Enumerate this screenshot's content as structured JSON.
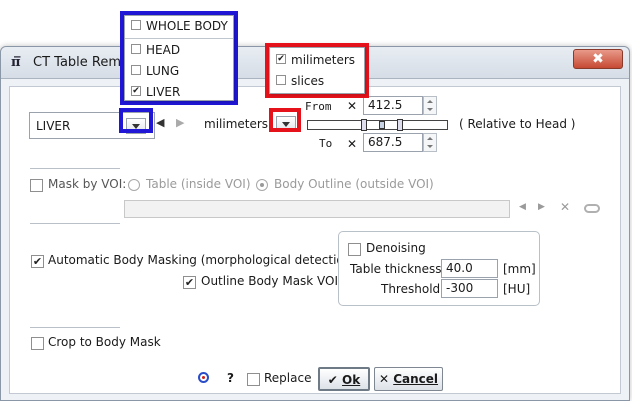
{
  "window": {
    "title": "CT Table Rem",
    "app_icon": "π̅",
    "close_symbol": "✖"
  },
  "region": {
    "selected": "LIVER",
    "options": [
      {
        "label": "WHOLE BODY",
        "checked": false
      },
      {
        "label": "HEAD",
        "checked": false
      },
      {
        "label": "LUNG",
        "checked": false
      },
      {
        "label": "LIVER",
        "checked": true
      }
    ]
  },
  "units": {
    "selected": "milimeters",
    "options": [
      {
        "label": "milimeters",
        "checked": true
      },
      {
        "label": "slices",
        "checked": false
      }
    ]
  },
  "range": {
    "from_label": "From",
    "from_value": "412.5",
    "to_label": "To",
    "to_value": "687.5",
    "clear_symbol": "✕",
    "relative_label": "( Relative to Head )"
  },
  "mask": {
    "mask_by_voi_label": "Mask by VOI:",
    "table_inside_label": "Table (inside VOI)",
    "body_outline_label": "Body Outline (outside VOI)",
    "voi_path": ""
  },
  "body_masking": {
    "auto_label": "Automatic Body Masking (morphological detection)",
    "auto_checked": true,
    "outline_label": "Outline Body Mask VOI",
    "outline_checked": true,
    "denoising_label": "Denoising",
    "table_thickness_label": "Table thickness",
    "table_thickness_value": "40.0",
    "table_thickness_unit": "[mm]",
    "threshold_label": "Threshold",
    "threshold_value": "-300",
    "threshold_unit": "[HU]"
  },
  "crop": {
    "label": "Crop to Body Mask",
    "checked": false
  },
  "footer": {
    "help_label": "?",
    "replace_label": "Replace",
    "ok_label": "Ok",
    "cancel_label": "Cancel",
    "check_symbol": "✔",
    "x_symbol": "✕"
  }
}
